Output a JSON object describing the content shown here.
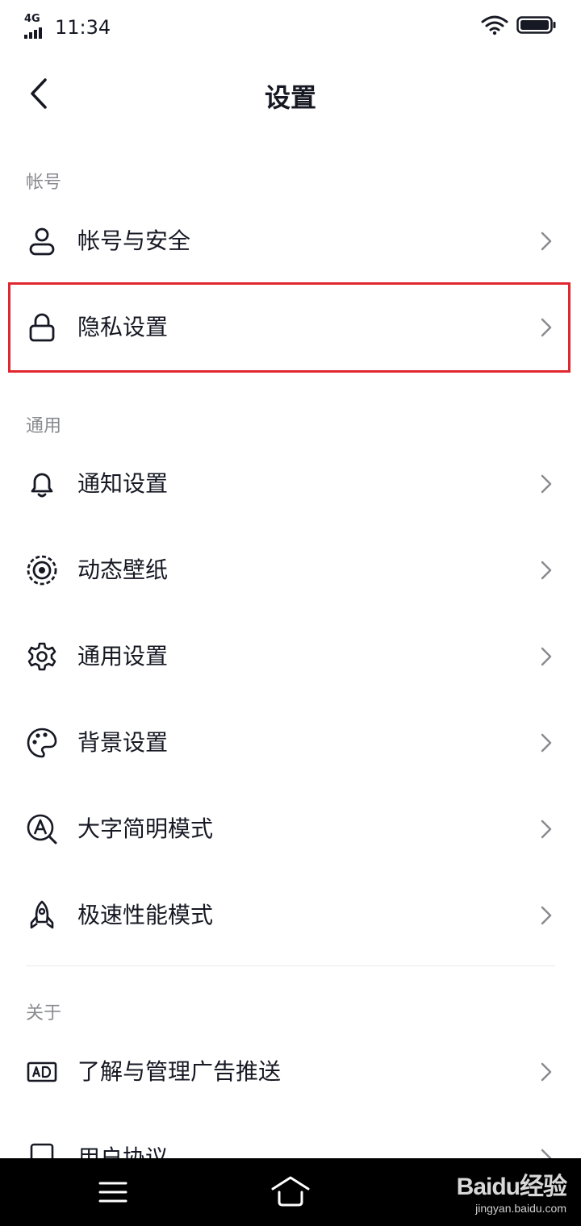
{
  "status_bar": {
    "network": "4G",
    "time": "11:34"
  },
  "header": {
    "title": "设置"
  },
  "sections": [
    {
      "header": "帐号",
      "items": [
        {
          "label": "帐号与安全",
          "icon": "user-icon"
        },
        {
          "label": "隐私设置",
          "icon": "lock-icon"
        }
      ]
    },
    {
      "header": "通用",
      "items": [
        {
          "label": "通知设置",
          "icon": "bell-icon"
        },
        {
          "label": "动态壁纸",
          "icon": "live-wallpaper-icon"
        },
        {
          "label": "通用设置",
          "icon": "gear-icon"
        },
        {
          "label": "背景设置",
          "icon": "palette-icon"
        },
        {
          "label": "大字简明模式",
          "icon": "large-text-icon"
        },
        {
          "label": "极速性能模式",
          "icon": "rocket-icon"
        }
      ]
    },
    {
      "header": "关于",
      "items": [
        {
          "label": "了解与管理广告推送",
          "icon": "ad-icon"
        },
        {
          "label": "用户协议",
          "icon": "document-icon"
        }
      ]
    }
  ],
  "watermark": {
    "text": "Baidu经验",
    "subtext": "jingyan.baidu.com"
  },
  "colors": {
    "highlight": "#e0272f",
    "text": "#161823",
    "secondary": "#8a8b91",
    "divider": "#e8e8ea"
  }
}
